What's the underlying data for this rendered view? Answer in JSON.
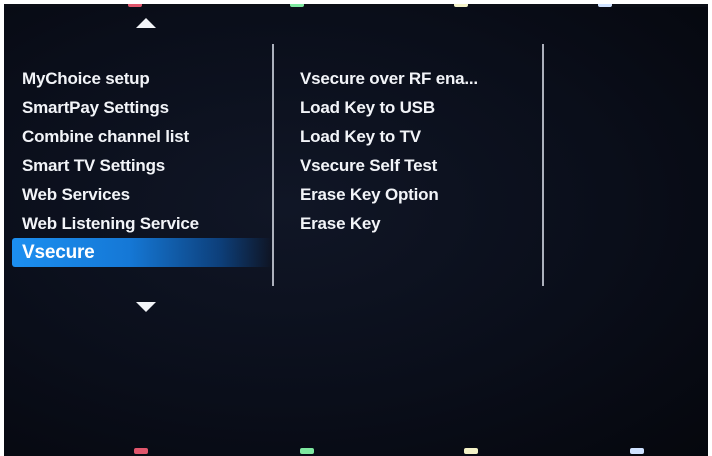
{
  "menu": {
    "items": [
      {
        "label": "MyChoice setup"
      },
      {
        "label": "SmartPay Settings"
      },
      {
        "label": "Combine channel list"
      },
      {
        "label": "Smart TV Settings"
      },
      {
        "label": "Web Services"
      },
      {
        "label": "Web Listening Service"
      },
      {
        "label": "Vsecure"
      }
    ],
    "selected_index": 6
  },
  "submenu": {
    "items": [
      {
        "label": "Vsecure over RF ena..."
      },
      {
        "label": "Load Key to USB"
      },
      {
        "label": "Load Key to TV"
      },
      {
        "label": "Vsecure Self Test"
      },
      {
        "label": "Erase Key Option"
      },
      {
        "label": "Erase Key"
      }
    ]
  },
  "navigation": {
    "up_icon": "triangle-up",
    "down_icon": "triangle-down"
  },
  "color_keys": [
    {
      "name": "red",
      "color": "#e0566c"
    },
    {
      "name": "green",
      "color": "#7ee8a0"
    },
    {
      "name": "yellow",
      "color": "#f4f2c8"
    },
    {
      "name": "blue",
      "color": "#cfe2ff"
    }
  ],
  "colors": {
    "selection_highlight": "#1c8ff0",
    "background": "#0a0e1a",
    "text": "#f2f4f8"
  }
}
